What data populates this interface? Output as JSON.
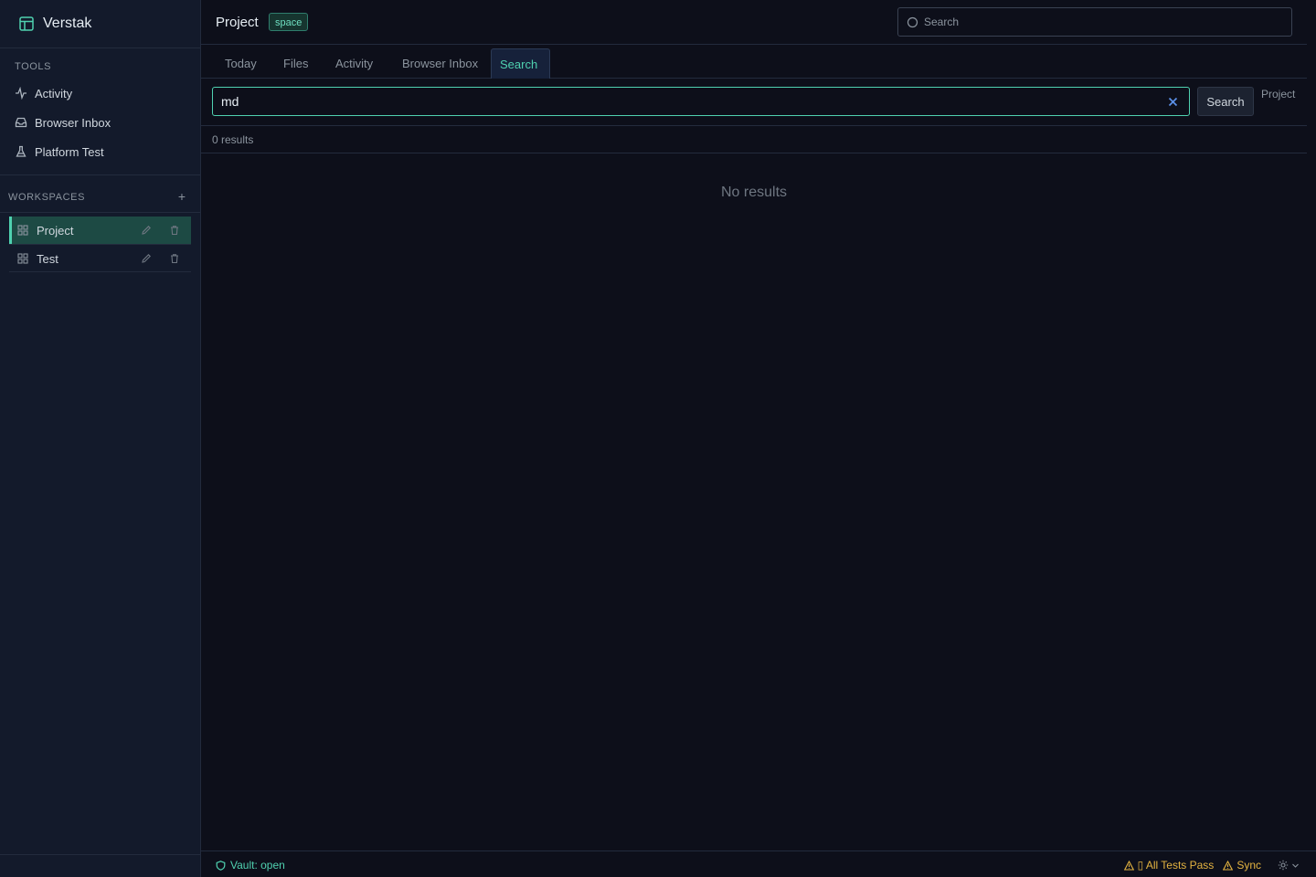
{
  "app": {
    "name": "Verstak",
    "accent": "#4fd1b0"
  },
  "sidebar": {
    "tools_label": "TOOLS",
    "tools": [
      {
        "label": "Activity",
        "icon": "activity-icon"
      },
      {
        "label": "Browser Inbox",
        "icon": "inbox-icon"
      },
      {
        "label": "Platform Test",
        "icon": "flask-icon"
      }
    ],
    "workspaces_label": "WORKSPACES",
    "add_label": "+",
    "workspaces": [
      {
        "label": "Project",
        "active": true
      },
      {
        "label": "Test",
        "active": false
      }
    ]
  },
  "header": {
    "title": "Project",
    "badge": "space",
    "search_placeholder": "Search"
  },
  "tabs": [
    {
      "label": "Today",
      "active": false
    },
    {
      "label": "Files",
      "active": false
    },
    {
      "label": "Activity",
      "active": false
    },
    {
      "label": "Browser Inbox",
      "active": false
    },
    {
      "label": "Search",
      "active": true
    }
  ],
  "search": {
    "query": "md",
    "button_label": "Search",
    "scope": "Project",
    "results_count": "0 results",
    "empty_message": "No results"
  },
  "statusbar": {
    "vault": "Vault: open",
    "tests": "▯ All Tests Pass",
    "sync": "Sync",
    "warn_color": "#e3b341"
  }
}
